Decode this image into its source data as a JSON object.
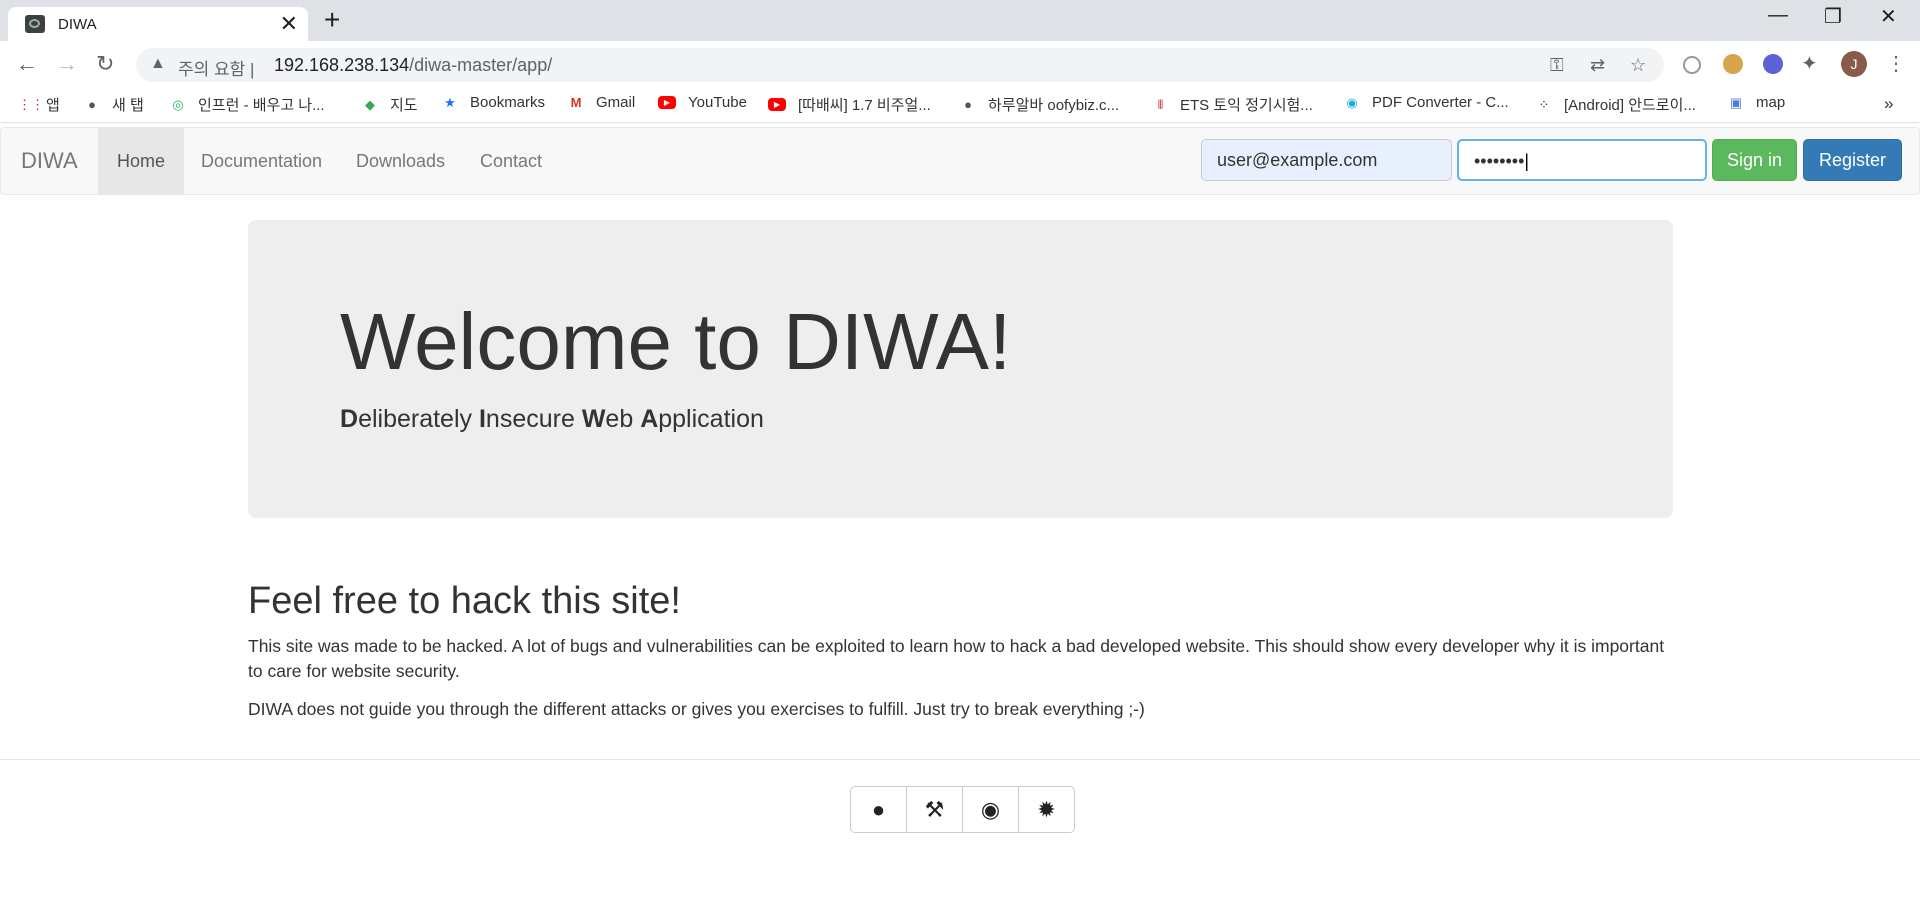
{
  "browser": {
    "tab_title": "DIWA",
    "tab_close": "✕",
    "new_tab": "+",
    "window": {
      "minimize": "—",
      "restore": "❐",
      "close": "✕"
    },
    "security_label": "주의 요함",
    "url_host": "192.168.238.134",
    "url_path": "/diwa-master/app/",
    "avatar_letter": "J",
    "bookmarks": [
      {
        "label": "앱",
        "icon": "apps-grid-icon"
      },
      {
        "label": "새 탭",
        "icon": "globe-icon"
      },
      {
        "label": "인프런 - 배우고 나...",
        "icon": "inflearn-icon"
      },
      {
        "label": "지도",
        "icon": "maps-icon"
      },
      {
        "label": "Bookmarks",
        "icon": "star-icon"
      },
      {
        "label": "Gmail",
        "icon": "gmail-icon"
      },
      {
        "label": "YouTube",
        "icon": "youtube-icon"
      },
      {
        "label": "[따배씨] 1.7 비주얼...",
        "icon": "youtube-icon"
      },
      {
        "label": "하루알바 oofybiz.c...",
        "icon": "globe-icon"
      },
      {
        "label": "ETS 토익 정기시험...",
        "icon": "ets-icon"
      },
      {
        "label": "PDF Converter - C...",
        "icon": "pdf-converter-icon"
      },
      {
        "label": "[Android] 안드로이...",
        "icon": "android-icon"
      },
      {
        "label": "map",
        "icon": "translate-icon"
      }
    ],
    "bookmarks_overflow": "»"
  },
  "navbar": {
    "brand": "DIWA",
    "items": [
      "Home",
      "Documentation",
      "Downloads",
      "Contact"
    ],
    "email_value": "user@example.com",
    "password_value": "••••••••",
    "signin_label": "Sign in",
    "register_label": "Register"
  },
  "jumbotron": {
    "title": "Welcome to DIWA!",
    "subtitle_parts": [
      {
        "bold": "D",
        "rest": "eliberately "
      },
      {
        "bold": "I",
        "rest": "nsecure "
      },
      {
        "bold": "W",
        "rest": "eb "
      },
      {
        "bold": "A",
        "rest": "pplication"
      }
    ]
  },
  "content": {
    "heading": "Feel free to hack this site!",
    "paragraph1": "This site was made to be hacked. A lot of bugs and vulnerabilities can be exploited to learn how to hack a bad developed website. This should show every developer why it is important to care for website security.",
    "paragraph2": "DIWA does not guide you through the different attacks or gives you exercises to fulfill. Just try to break everything ;-)"
  },
  "footer_buttons": [
    {
      "icon": "bomb-icon"
    },
    {
      "icon": "gavel-icon"
    },
    {
      "icon": "github-icon"
    },
    {
      "icon": "bug-icon"
    }
  ],
  "colors": {
    "signin": "#5cb85c",
    "register": "#337ab7",
    "jumbotron_bg": "#eeeeee",
    "navbar_bg": "#f8f8f8"
  }
}
